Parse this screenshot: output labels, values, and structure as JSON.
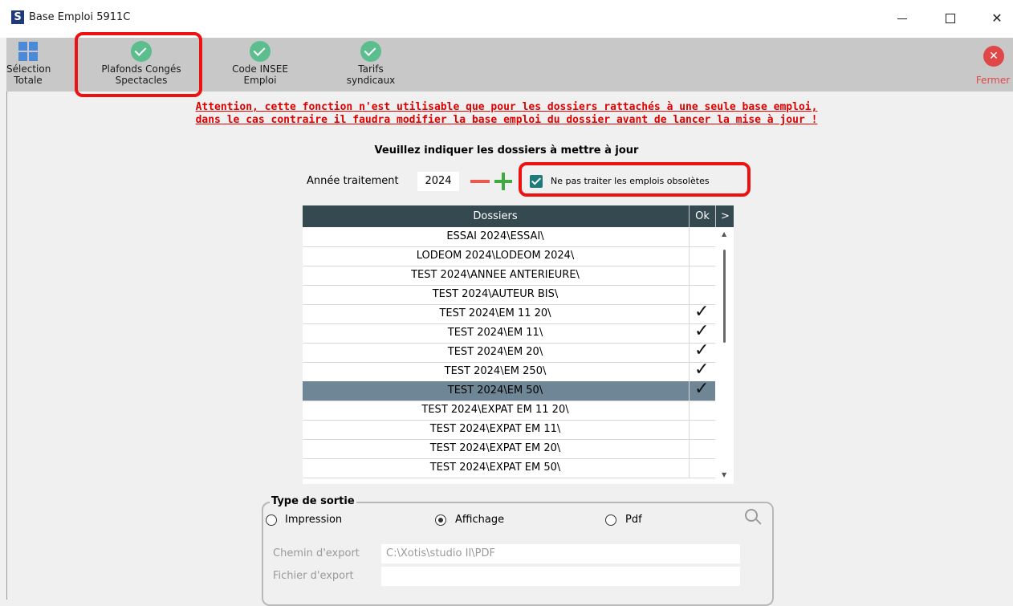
{
  "window": {
    "logo": "S",
    "title": "Base Emploi 5911C",
    "controls": {
      "minimize": "—",
      "maximize": "☐",
      "close": "✕"
    }
  },
  "toolbar": {
    "selection_totale": {
      "line1": "Sélection",
      "line2": "Totale",
      "icon": "grid-icon"
    },
    "plafonds": {
      "line1": "Plafonds Congés",
      "line2": "Spectacles",
      "icon": "check-icon"
    },
    "code_insee": {
      "line1": "Code INSEE",
      "line2": "Emploi",
      "icon": "check-icon"
    },
    "tarifs": {
      "line1": "Tarifs",
      "line2": "syndicaux",
      "icon": "check-icon"
    },
    "fermer": {
      "label": "Fermer",
      "icon": "close-icon"
    }
  },
  "warning": {
    "line1": "Attention, cette fonction n'est utilisable que pour les dossiers rattachés à une seule base emploi,",
    "line2": "dans le cas contraire il faudra modifier la base emploi du dossier avant de lancer la mise à jour !"
  },
  "instruction": "Veuillez indiquer les dossiers à mettre à jour",
  "year": {
    "label": "Année traitement",
    "value": "2024"
  },
  "obsolete_checkbox": {
    "label": "Ne pas traiter les emplois obsolètes",
    "checked": true
  },
  "table": {
    "columns": {
      "dossiers": "Dossiers",
      "ok": "Ok",
      "more": ">"
    },
    "rows": [
      {
        "name": "ESSAI 2024\\ESSAI\\",
        "ok": false,
        "selected": false
      },
      {
        "name": "LODEOM 2024\\LODEOM 2024\\",
        "ok": false,
        "selected": false
      },
      {
        "name": "TEST 2024\\ANNEE ANTERIEURE\\",
        "ok": false,
        "selected": false
      },
      {
        "name": "TEST 2024\\AUTEUR BIS\\",
        "ok": false,
        "selected": false
      },
      {
        "name": "TEST 2024\\EM 11 20\\",
        "ok": true,
        "selected": false
      },
      {
        "name": "TEST 2024\\EM 11\\",
        "ok": true,
        "selected": false
      },
      {
        "name": "TEST 2024\\EM 20\\",
        "ok": true,
        "selected": false
      },
      {
        "name": "TEST 2024\\EM 250\\",
        "ok": true,
        "selected": false
      },
      {
        "name": "TEST 2024\\EM 50\\",
        "ok": true,
        "selected": true
      },
      {
        "name": "TEST 2024\\EXPAT EM 11 20\\",
        "ok": false,
        "selected": false
      },
      {
        "name": "TEST 2024\\EXPAT EM 11\\",
        "ok": false,
        "selected": false
      },
      {
        "name": "TEST 2024\\EXPAT EM 20\\",
        "ok": false,
        "selected": false
      },
      {
        "name": "TEST 2024\\EXPAT EM 50\\",
        "ok": false,
        "selected": false
      }
    ],
    "tick": "✓"
  },
  "output": {
    "title": "Type de sortie",
    "options": {
      "impression": "Impression",
      "affichage": "Affichage",
      "pdf": "Pdf"
    },
    "selected": "affichage",
    "chemin_label": "Chemin d'export",
    "chemin_value": "C:\\Xotis\\studio II\\PDF",
    "fichier_label": "Fichier d'export",
    "fichier_value": ""
  },
  "colors": {
    "accent_check": "#5cbe8e",
    "warning_red": "#e00000",
    "header_bg": "#354951",
    "selected_row": "#6f8696",
    "highlight_box": "#ee1111"
  }
}
